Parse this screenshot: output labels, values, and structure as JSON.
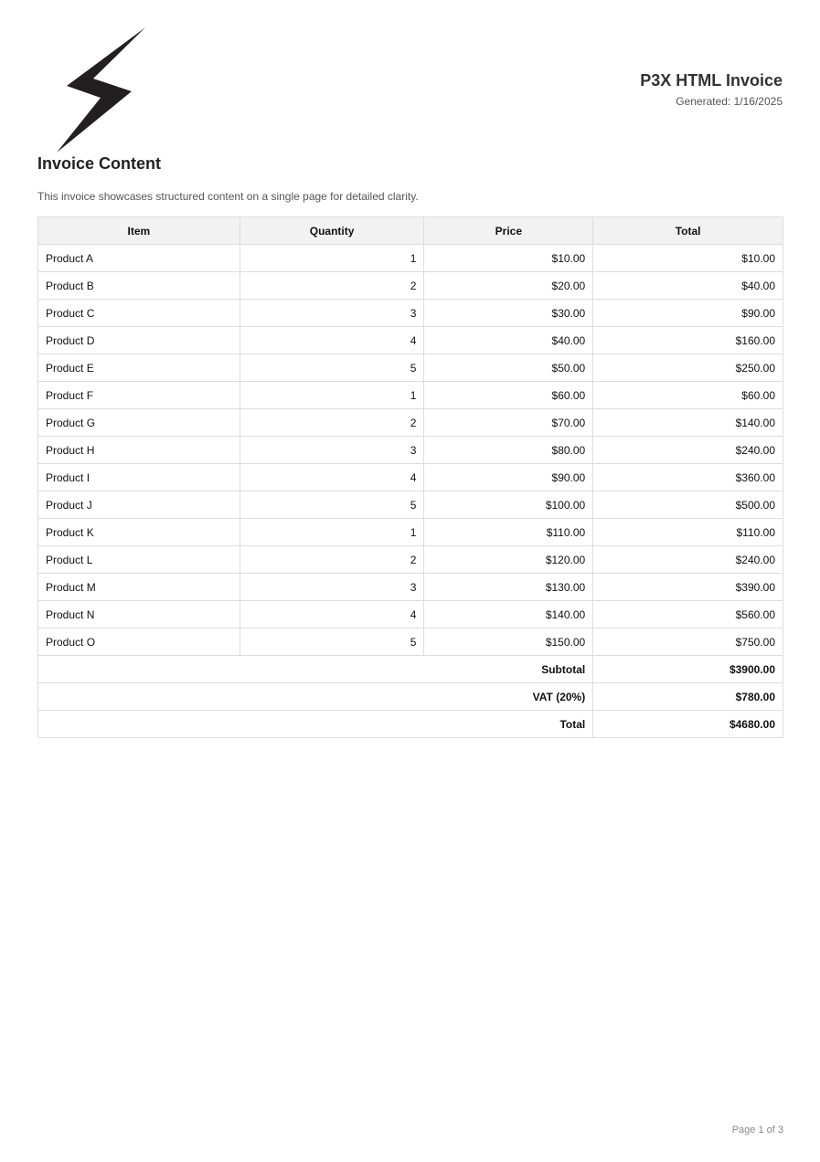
{
  "header": {
    "title": "P3X HTML Invoice",
    "generated_label": "Generated:",
    "generated_date": "1/16/2025",
    "logo_icon": "lightning-bolt-icon"
  },
  "content": {
    "heading": "Invoice Content",
    "description": "This invoice showcases structured content on a single page for detailed clarity."
  },
  "table": {
    "columns": [
      "Item",
      "Quantity",
      "Price",
      "Total"
    ],
    "rows": [
      {
        "item": "Product A",
        "quantity": "1",
        "price": "$10.00",
        "total": "$10.00"
      },
      {
        "item": "Product B",
        "quantity": "2",
        "price": "$20.00",
        "total": "$40.00"
      },
      {
        "item": "Product C",
        "quantity": "3",
        "price": "$30.00",
        "total": "$90.00"
      },
      {
        "item": "Product D",
        "quantity": "4",
        "price": "$40.00",
        "total": "$160.00"
      },
      {
        "item": "Product E",
        "quantity": "5",
        "price": "$50.00",
        "total": "$250.00"
      },
      {
        "item": "Product F",
        "quantity": "1",
        "price": "$60.00",
        "total": "$60.00"
      },
      {
        "item": "Product G",
        "quantity": "2",
        "price": "$70.00",
        "total": "$140.00"
      },
      {
        "item": "Product H",
        "quantity": "3",
        "price": "$80.00",
        "total": "$240.00"
      },
      {
        "item": "Product I",
        "quantity": "4",
        "price": "$90.00",
        "total": "$360.00"
      },
      {
        "item": "Product J",
        "quantity": "5",
        "price": "$100.00",
        "total": "$500.00"
      },
      {
        "item": "Product K",
        "quantity": "1",
        "price": "$110.00",
        "total": "$110.00"
      },
      {
        "item": "Product L",
        "quantity": "2",
        "price": "$120.00",
        "total": "$240.00"
      },
      {
        "item": "Product M",
        "quantity": "3",
        "price": "$130.00",
        "total": "$390.00"
      },
      {
        "item": "Product N",
        "quantity": "4",
        "price": "$140.00",
        "total": "$560.00"
      },
      {
        "item": "Product O",
        "quantity": "5",
        "price": "$150.00",
        "total": "$750.00"
      }
    ],
    "summary": [
      {
        "label": "Subtotal",
        "value": "$3900.00"
      },
      {
        "label": "VAT (20%)",
        "value": "$780.00"
      },
      {
        "label": "Total",
        "value": "$4680.00"
      }
    ]
  },
  "footer": {
    "page": "Page 1 of 3"
  },
  "colors": {
    "logo": "#231f20",
    "header_bg": "#f2f2f2",
    "border": "#dddddd",
    "muted_text": "#555555"
  }
}
